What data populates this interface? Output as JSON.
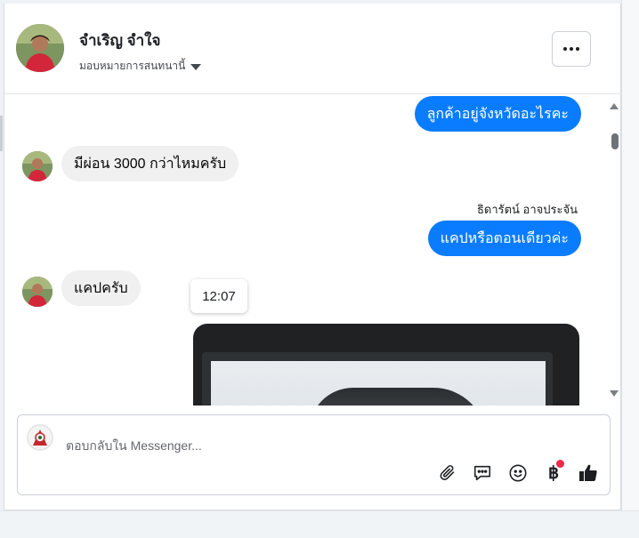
{
  "header": {
    "name": "จำเริญ จำใจ",
    "assign_label": "มอบหมายการสนทนานี้"
  },
  "thread": {
    "messages": [
      {
        "side": "out",
        "text": "ลูกค้าอยู่จังหวัดอะไรคะ"
      },
      {
        "side": "in",
        "text": "มีผ่อน 3000 กว่าไหมครับ"
      },
      {
        "side": "out",
        "text": "แคปหรือตอนเดียวค่ะ",
        "sender": "ธิดารัตน์ อาจประจัน"
      },
      {
        "side": "in",
        "text": "แคปครับ"
      }
    ],
    "tooltip_time": "12:07"
  },
  "composer": {
    "placeholder": "ตอบกลับใน Messenger...",
    "icons": [
      "paperclip-icon",
      "saved-reply-icon",
      "emoji-icon",
      "baht-payment-icon",
      "thumbs-up-icon"
    ],
    "payment_symbol": "฿"
  },
  "colors": {
    "outgoing_bubble": "#0a7cff",
    "incoming_bubble": "#f0f0f0",
    "notification_dot": "#f02849"
  }
}
